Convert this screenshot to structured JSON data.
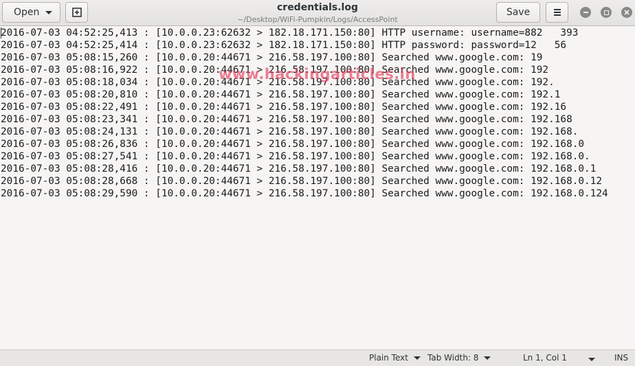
{
  "header": {
    "open_label": "Open",
    "save_label": "Save",
    "title": "credentials.log",
    "subtitle": "~/Desktop/WiFi-Pumpkin/Logs/AccessPoint"
  },
  "icons": {
    "new_tab": "new-document-icon",
    "menu": "hamburger-menu-icon",
    "minimize": "minimize-icon",
    "maximize": "maximize-icon",
    "close": "close-icon"
  },
  "editor": {
    "lines": [
      "2016-07-03 04:52:25,413 : [10.0.0.23:62632 > 182.18.171.150:80] HTTP username: username=882   393",
      "2016-07-03 04:52:25,414 : [10.0.0.23:62632 > 182.18.171.150:80] HTTP password: password=12   56",
      "2016-07-03 05:08:15,260 : [10.0.0.20:44671 > 216.58.197.100:80] Searched www.google.com: 19",
      "2016-07-03 05:08:16,922 : [10.0.0.20:44671 > 216.58.197.100:80] Searched www.google.com: 192",
      "2016-07-03 05:08:18,034 : [10.0.0.20:44671 > 216.58.197.100:80] Searched www.google.com: 192.",
      "2016-07-03 05:08:20,810 : [10.0.0.20:44671 > 216.58.197.100:80] Searched www.google.com: 192.1",
      "2016-07-03 05:08:22,491 : [10.0.0.20:44671 > 216.58.197.100:80] Searched www.google.com: 192.16",
      "2016-07-03 05:08:23,341 : [10.0.0.20:44671 > 216.58.197.100:80] Searched www.google.com: 192.168",
      "2016-07-03 05:08:24,131 : [10.0.0.20:44671 > 216.58.197.100:80] Searched www.google.com: 192.168.",
      "2016-07-03 05:08:26,836 : [10.0.0.20:44671 > 216.58.197.100:80] Searched www.google.com: 192.168.0",
      "2016-07-03 05:08:27,541 : [10.0.0.20:44671 > 216.58.197.100:80] Searched www.google.com: 192.168.0.",
      "2016-07-03 05:08:28,416 : [10.0.0.20:44671 > 216.58.197.100:80] Searched www.google.com: 192.168.0.1",
      "2016-07-03 05:08:28,668 : [10.0.0.20:44671 > 216.58.197.100:80] Searched www.google.com: 192.168.0.12",
      "2016-07-03 05:08:29,590 : [10.0.0.20:44671 > 216.58.197.100:80] Searched www.google.com: 192.168.0.124"
    ],
    "watermark": "www.hackingarticles.in"
  },
  "statusbar": {
    "language": "Plain Text",
    "tab_width": "Tab Width: 8",
    "position": "Ln 1, Col 1",
    "mode": "INS"
  }
}
